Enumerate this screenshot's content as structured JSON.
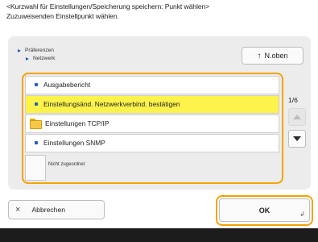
{
  "header": {
    "line1": "<Kurzwahl für Einstellungen/Speicherung speichern: Punkt wählen>",
    "line2": "Zuzuweisenden Einstellpunkt wählen."
  },
  "breadcrumb": {
    "level1": "Präferenzen",
    "level2": "Netzwerk"
  },
  "toolbar": {
    "up_icon": "↑",
    "up_label": "N.oben"
  },
  "list": {
    "items": [
      {
        "label": "Ausgabebericht",
        "icon": "bullet-icon"
      },
      {
        "label": "Einstellungsänd. Netzwerkverbind. bestätigen",
        "icon": "bullet-icon",
        "selected": true
      },
      {
        "label": "Einstellungen TCP/IP",
        "icon": "folder-icon"
      },
      {
        "label": "Einstellungen SNMP",
        "icon": "bullet-icon"
      }
    ],
    "not_assigned_label": "Nicht zugeordnet"
  },
  "pagination": {
    "indicator": "1/6"
  },
  "footer": {
    "cancel_icon": "×",
    "cancel_label": "Abbrechen",
    "ok_label": "OK",
    "ok_enter_icon": "↲"
  },
  "colors": {
    "accent_outline": "#f5a300",
    "selected_row": "#fdf34a",
    "bullet": "#1e5fb8",
    "bottom_bar": "#1c1c1c"
  }
}
